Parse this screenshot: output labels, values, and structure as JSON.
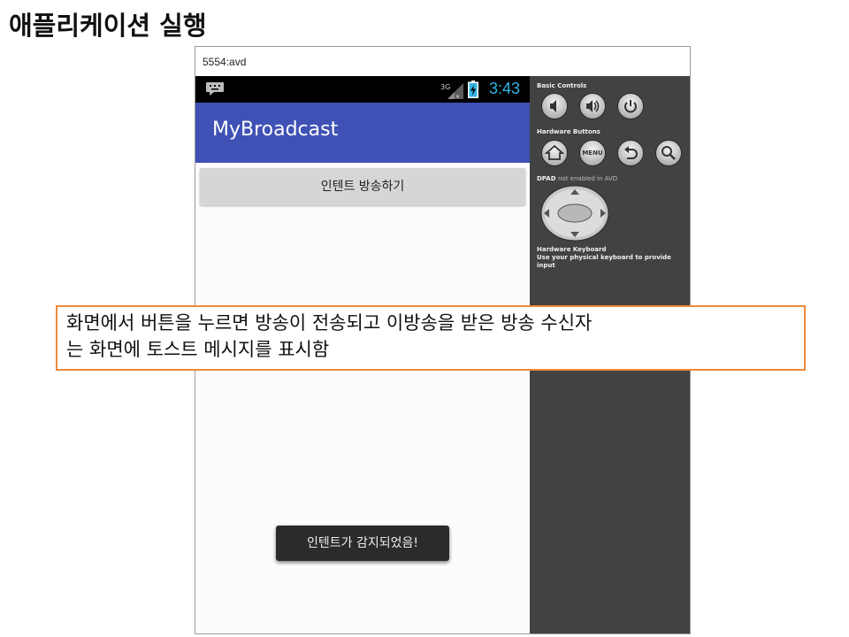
{
  "slide": {
    "title": "애플리케이션 실행"
  },
  "emulator": {
    "window_title": "5554:avd",
    "status_bar": {
      "network": "3G",
      "time": "3:43"
    },
    "app": {
      "title": "MyBroadcast",
      "send_button_label": "인텐트 방송하기",
      "toast_message": "인텐트가 감지되었음!"
    },
    "controls": {
      "basic_controls_label": "Basic Controls",
      "basic_buttons": [
        "volume-down-icon",
        "volume-up-icon",
        "power-icon"
      ],
      "hardware_buttons_label": "Hardware Buttons",
      "hardware_buttons": [
        "home-icon",
        "menu-icon",
        "back-icon",
        "search-icon"
      ],
      "menu_label": "MENU",
      "dpad_label": "DPAD",
      "dpad_status": "not enabled in AVD",
      "keyboard_label": "Hardware Keyboard",
      "keyboard_hint": "Use your physical keyboard to provide input"
    }
  },
  "callout": {
    "line1": "화면에서 버튼을 누르면 방송이 전송되고 이방송을 받은 방송 수신자",
    "line2": "는 화면에 토스트 메시지를 표시함"
  },
  "colors": {
    "app_bar": "#3f51b5",
    "control_panel": "#424242",
    "clock": "#33b5e5",
    "callout_border": "#ed8a3c"
  }
}
